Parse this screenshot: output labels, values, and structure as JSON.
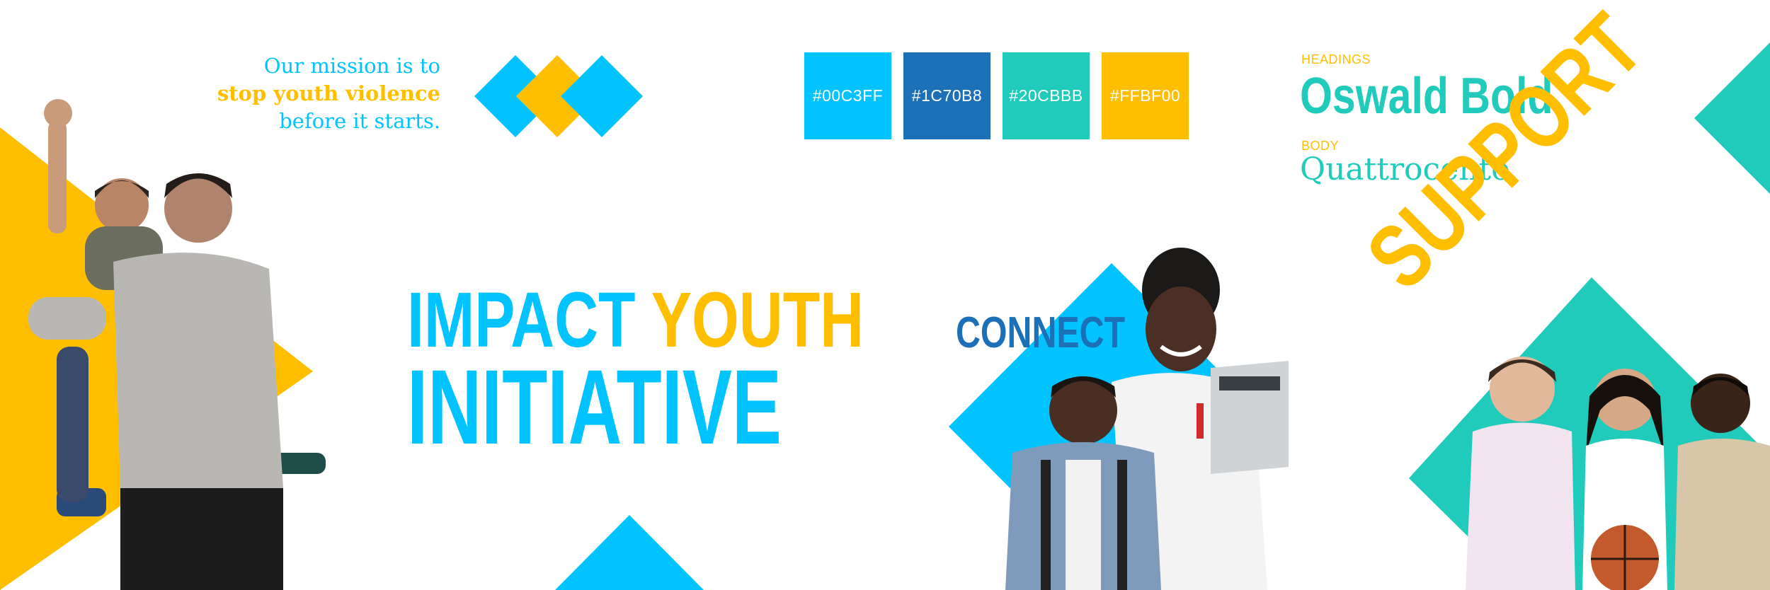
{
  "mission": {
    "line1": "Our mission is to",
    "line2": "stop youth violence",
    "line3": "before it starts."
  },
  "palette": [
    {
      "label": "#00C3FF",
      "color": "#00c3ff"
    },
    {
      "label": "#1C70B8",
      "color": "#1c70b8"
    },
    {
      "label": "#20CBBB",
      "color": "#20cbbb"
    },
    {
      "label": "#FFBF00",
      "color": "#ffbf00"
    }
  ],
  "typography": {
    "headings_label": "HEADINGS",
    "headings_font": "Oswald Bold",
    "body_label": "BODY",
    "body_font": "Quattrocento"
  },
  "headline": {
    "word1": "IMPACT",
    "word2": "YOUTH",
    "word3": "INITIATIVE"
  },
  "sections": {
    "connect": "CONNECT",
    "support": "SUPPORT"
  },
  "colors": {
    "blue": "#00c3ff",
    "dark_blue": "#1c70b8",
    "teal": "#20cbbb",
    "yellow": "#ffbf00"
  }
}
